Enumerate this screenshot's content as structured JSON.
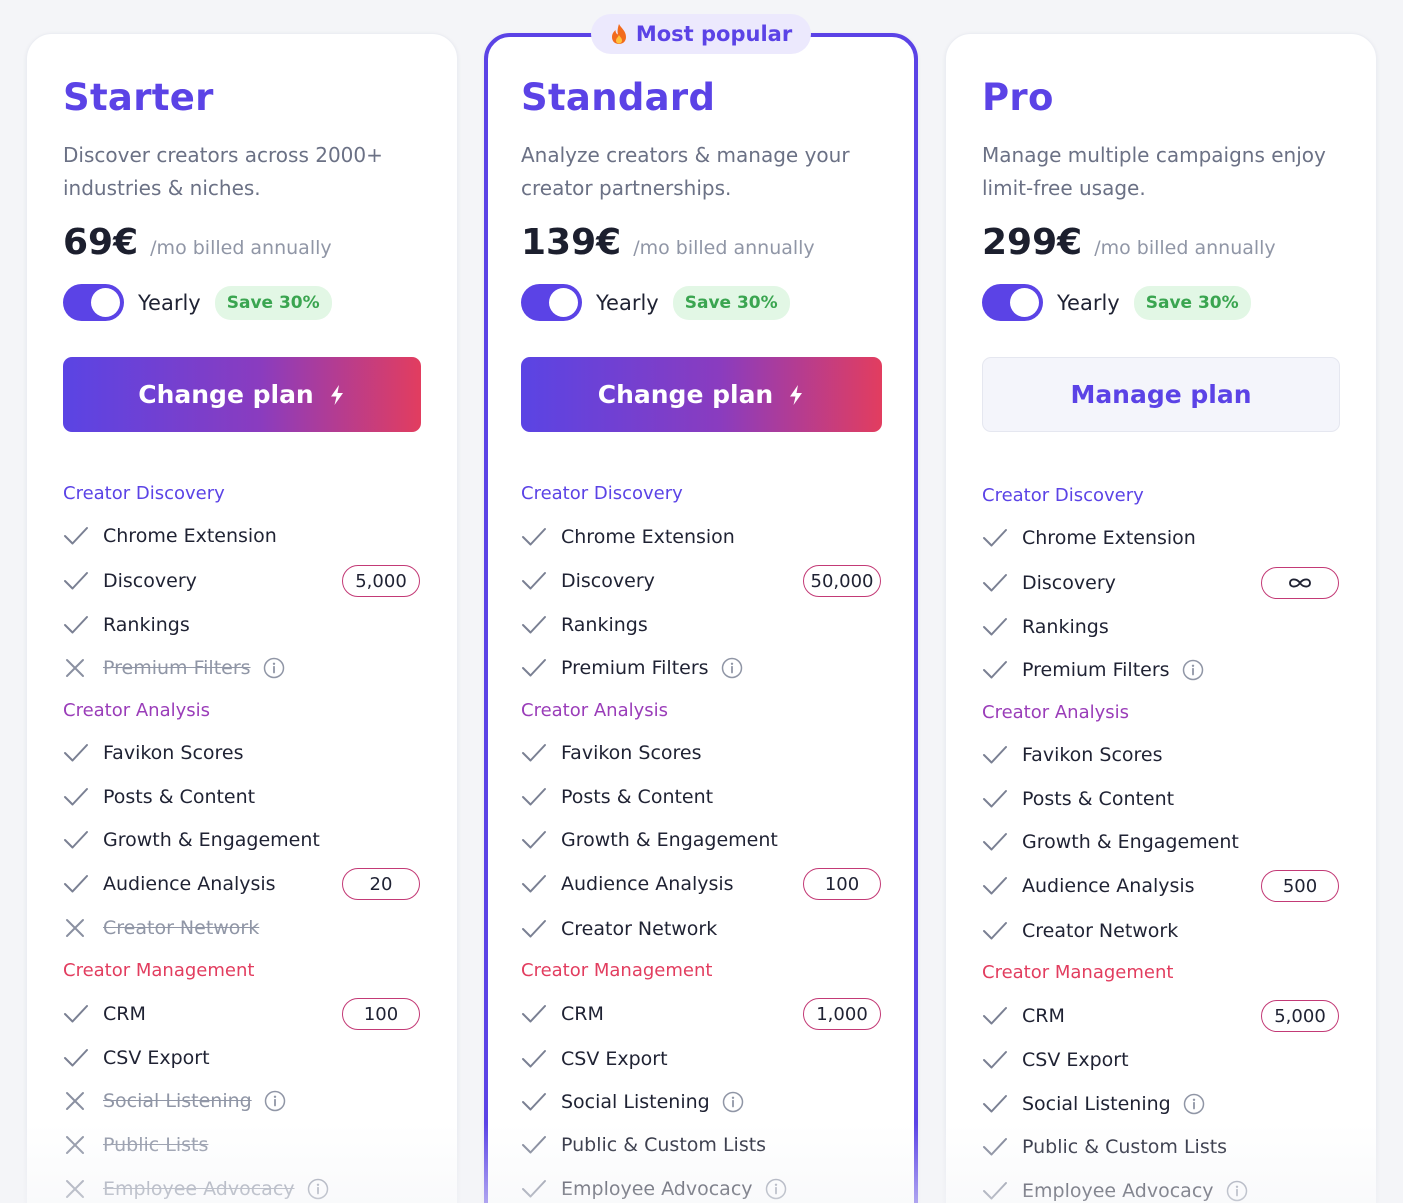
{
  "badge": {
    "emoji": "🔥",
    "text": "Most popular"
  },
  "plans": [
    {
      "name": "Starter",
      "description": "Discover creators across 2000+ industries & niches.",
      "price": "69€",
      "period": "/mo billed annually",
      "toggle_label": "Yearly",
      "save_label": "Save 30%",
      "cta_label": "Change plan",
      "sections": [
        {
          "title": "Creator Discovery",
          "features": [
            {
              "label": "Chrome Extension",
              "included": true
            },
            {
              "label": "Discovery",
              "included": true,
              "limit": "5,000"
            },
            {
              "label": "Rankings",
              "included": true
            },
            {
              "label": "Premium Filters",
              "included": false,
              "info": true
            }
          ]
        },
        {
          "title": "Creator Analysis",
          "features": [
            {
              "label": "Favikon Scores",
              "included": true
            },
            {
              "label": "Posts & Content",
              "included": true
            },
            {
              "label": "Growth & Engagement",
              "included": true
            },
            {
              "label": "Audience Analysis",
              "included": true,
              "limit": "20"
            },
            {
              "label": "Creator Network",
              "included": false
            }
          ]
        },
        {
          "title": "Creator Management",
          "features": [
            {
              "label": "CRM",
              "included": true,
              "limit": "100"
            },
            {
              "label": "CSV Export",
              "included": true
            },
            {
              "label": "Social Listening",
              "included": false,
              "info": true
            },
            {
              "label": "Public Lists",
              "included": false
            },
            {
              "label": "Employee Advocacy",
              "included": false,
              "info": true
            }
          ]
        }
      ]
    },
    {
      "name": "Standard",
      "description": "Analyze creators & manage your creator partnerships.",
      "price": "139€",
      "period": "/mo billed annually",
      "toggle_label": "Yearly",
      "save_label": "Save 30%",
      "cta_label": "Change plan",
      "sections": [
        {
          "title": "Creator Discovery",
          "features": [
            {
              "label": "Chrome Extension",
              "included": true
            },
            {
              "label": "Discovery",
              "included": true,
              "limit": "50,000"
            },
            {
              "label": "Rankings",
              "included": true
            },
            {
              "label": "Premium Filters",
              "included": true,
              "info": true
            }
          ]
        },
        {
          "title": "Creator Analysis",
          "features": [
            {
              "label": "Favikon Scores",
              "included": true
            },
            {
              "label": "Posts & Content",
              "included": true
            },
            {
              "label": "Growth & Engagement",
              "included": true
            },
            {
              "label": "Audience Analysis",
              "included": true,
              "limit": "100"
            },
            {
              "label": "Creator Network",
              "included": true
            }
          ]
        },
        {
          "title": "Creator Management",
          "features": [
            {
              "label": "CRM",
              "included": true,
              "limit": "1,000"
            },
            {
              "label": "CSV Export",
              "included": true
            },
            {
              "label": "Social Listening",
              "included": true,
              "info": true
            },
            {
              "label": "Public & Custom Lists",
              "included": true
            },
            {
              "label": "Employee Advocacy",
              "included": true,
              "info": true
            }
          ]
        }
      ]
    },
    {
      "name": "Pro",
      "description": "Manage multiple campaigns enjoy limit-free usage.",
      "price": "299€",
      "period": "/mo billed annually",
      "toggle_label": "Yearly",
      "save_label": "Save 30%",
      "cta_label": "Manage plan",
      "sections": [
        {
          "title": "Creator Discovery",
          "features": [
            {
              "label": "Chrome Extension",
              "included": true
            },
            {
              "label": "Discovery",
              "included": true,
              "limit_icon": "infinity-icon"
            },
            {
              "label": "Rankings",
              "included": true
            },
            {
              "label": "Premium Filters",
              "included": true,
              "info": true
            }
          ]
        },
        {
          "title": "Creator Analysis",
          "features": [
            {
              "label": "Favikon Scores",
              "included": true
            },
            {
              "label": "Posts & Content",
              "included": true
            },
            {
              "label": "Growth & Engagement",
              "included": true
            },
            {
              "label": "Audience Analysis",
              "included": true,
              "limit": "500"
            },
            {
              "label": "Creator Network",
              "included": true
            }
          ]
        },
        {
          "title": "Creator Management",
          "features": [
            {
              "label": "CRM",
              "included": true,
              "limit": "5,000"
            },
            {
              "label": "CSV Export",
              "included": true
            },
            {
              "label": "Social Listening",
              "included": true,
              "info": true
            },
            {
              "label": "Public & Custom Lists",
              "included": true
            },
            {
              "label": "Employee Advocacy",
              "included": true,
              "info": true
            }
          ]
        }
      ]
    }
  ],
  "colors": {
    "accent": "#5b43e6",
    "analysis": "#9a3db9",
    "management": "#e23d5f",
    "save_green": "#3aa550"
  }
}
